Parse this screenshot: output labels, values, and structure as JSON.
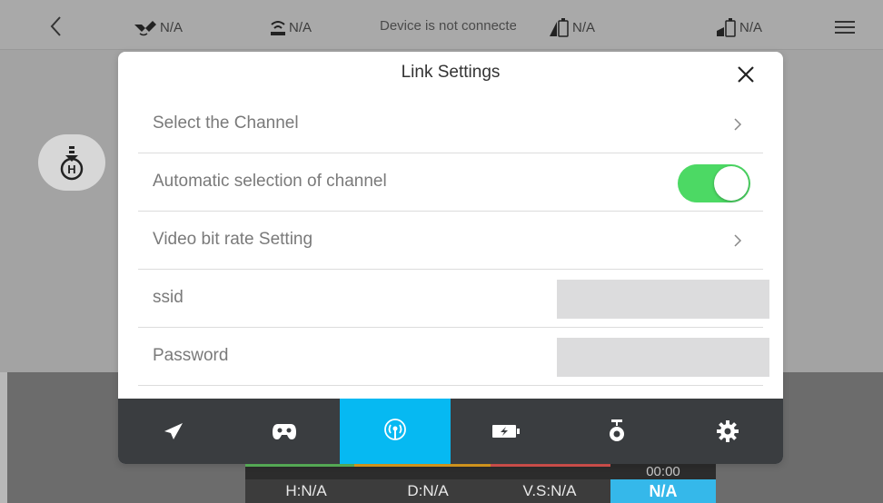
{
  "topbar": {
    "gps": "N/A",
    "signal": "N/A",
    "status": "Device is not connected",
    "rc_battery": "N/A",
    "aircraft_battery": "N/A"
  },
  "telemetry": {
    "height": "H:N/A",
    "distance": "D:N/A",
    "vertical_speed": "V.S:N/A",
    "flight_time": "00:00",
    "value": "N/A"
  },
  "modal": {
    "title": "Link Settings",
    "rows": [
      {
        "label": "Select the Channel"
      },
      {
        "label": "Automatic selection of channel",
        "toggle_on": true
      },
      {
        "label": "Video bit rate Setting"
      },
      {
        "label": "ssid",
        "value": ""
      },
      {
        "label": "Password",
        "value": ""
      }
    ],
    "tabs": [
      {
        "icon": "paper-plane-icon",
        "active": false
      },
      {
        "icon": "gamepad-icon",
        "active": false
      },
      {
        "icon": "wireless-link-icon",
        "active": true
      },
      {
        "icon": "battery-icon",
        "active": false
      },
      {
        "icon": "gimbal-camera-icon",
        "active": false
      },
      {
        "icon": "gear-icon",
        "active": false
      }
    ]
  },
  "colors": {
    "accent": "#06b9f2",
    "toggle_on": "#4cd964",
    "tabbar": "#3a3d40"
  }
}
